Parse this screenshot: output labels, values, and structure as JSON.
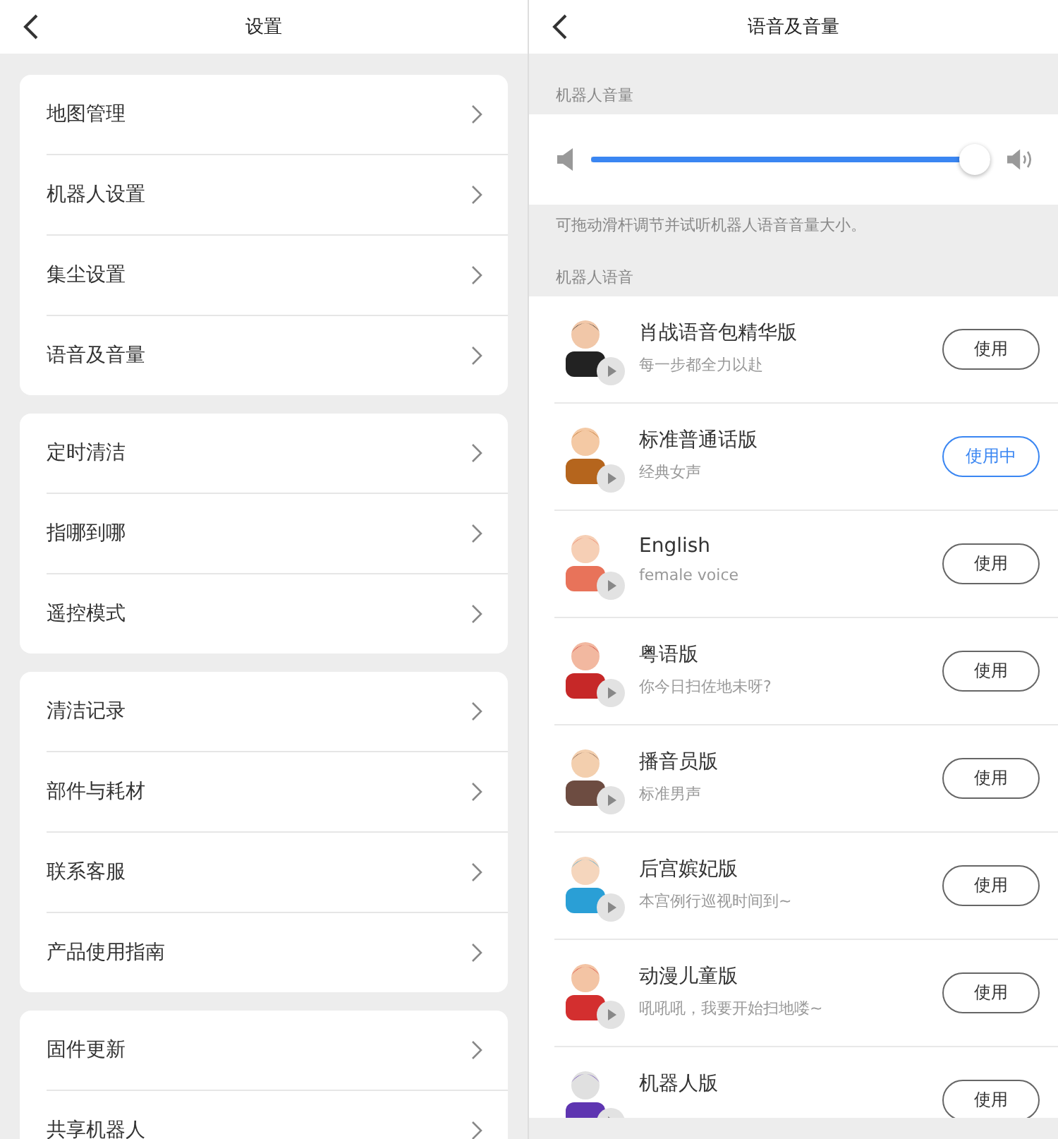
{
  "settings_screen": {
    "title": "设置",
    "groups": [
      {
        "items": [
          "地图管理",
          "机器人设置",
          "集尘设置",
          "语音及音量"
        ]
      },
      {
        "items": [
          "定时清洁",
          "指哪到哪",
          "遥控模式"
        ]
      },
      {
        "items": [
          "清洁记录",
          "部件与耗材",
          "联系客服",
          "产品使用指南"
        ]
      },
      {
        "items": [
          "固件更新",
          "共享机器人"
        ]
      }
    ]
  },
  "voice_screen": {
    "title": "语音及音量",
    "volume_section": "机器人音量",
    "volume": {
      "level": 0.96
    },
    "volume_hint": "可拖动滑杆调节并试听机器人语音音量大小。",
    "voice_section": "机器人语音",
    "voices": [
      {
        "name": "肖战语音包精华版",
        "description": "每一步都全力以赴",
        "button": "使用",
        "selected": false
      },
      {
        "name": "标准普通话版",
        "description": "经典女声",
        "button": "使用中",
        "selected": true
      },
      {
        "name": "English",
        "description": "female voice",
        "button": "使用",
        "selected": false
      },
      {
        "name": "粤语版",
        "description": "你今日扫佐地未呀?",
        "button": "使用",
        "selected": false
      },
      {
        "name": "播音员版",
        "description": "标准男声",
        "button": "使用",
        "selected": false
      },
      {
        "name": "后宫嫔妃版",
        "description": "本宫例行巡视时间到~",
        "button": "使用",
        "selected": false
      },
      {
        "name": "动漫儿童版",
        "description": "吼吼吼，我要开始扫地喽~",
        "button": "使用",
        "selected": false
      },
      {
        "name": "机器人版",
        "button": "使用",
        "selected": false
      }
    ]
  }
}
